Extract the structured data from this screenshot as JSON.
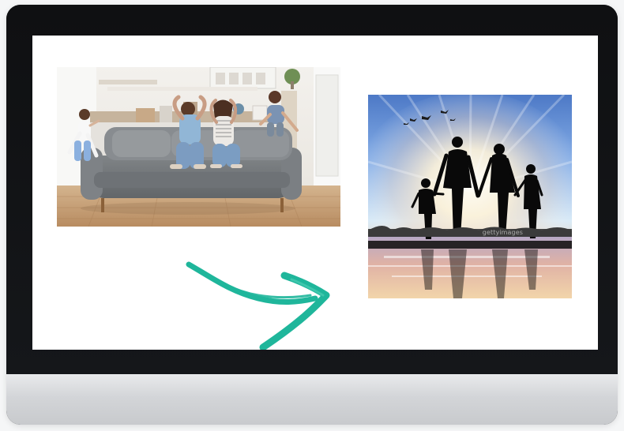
{
  "images": {
    "stressed_family": {
      "label": "family-stressed-on-sofa-photo"
    },
    "happy_family": {
      "label": "family-silhouette-sunset-photo",
      "watermark": "gettyimages"
    }
  },
  "arrow": {
    "icon": "right-arrow-icon",
    "color": "#1fb69b"
  }
}
